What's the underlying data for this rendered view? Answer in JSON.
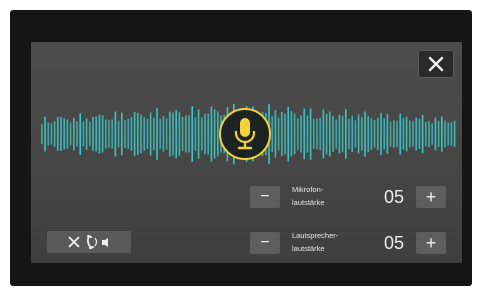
{
  "close_icon": "close-icon",
  "mic_icon": "microphone-icon",
  "mute_button": {
    "icons": [
      "close-icon",
      "handset-volume-icon"
    ]
  },
  "controls": [
    {
      "label_line1": "Mikrofon-",
      "label_line2": "lautstärke",
      "value": "05",
      "minus": "−",
      "plus": "+"
    },
    {
      "label_line1": "Lautsprecher-",
      "label_line2": "lautstärke",
      "value": "05",
      "minus": "−",
      "plus": "+"
    }
  ],
  "colors": {
    "accent": "#f0d23a",
    "wave": "#39c9c4",
    "screen": "#474747"
  }
}
